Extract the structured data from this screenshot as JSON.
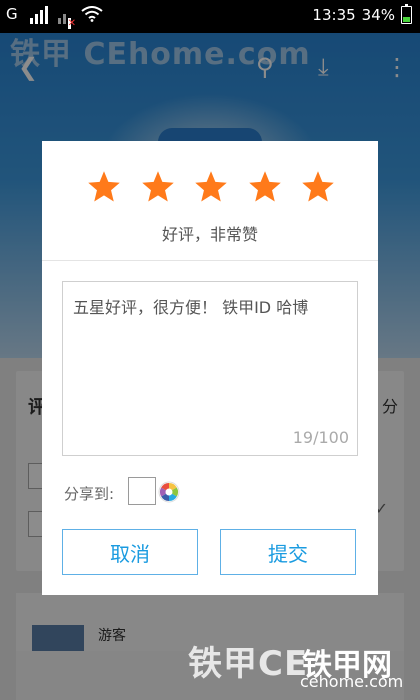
{
  "status_bar": {
    "network_label": "G",
    "time": "13:35",
    "battery_percent": "34%",
    "battery_level": 0.34,
    "icons": [
      "signal-icon",
      "sim-no-signal-icon",
      "wifi-icon",
      "battery-icon"
    ]
  },
  "background": {
    "brand_watermark": "铁甲 CEhome.com",
    "card_title_fragment": "评",
    "card_right_fragment": "分",
    "guest_label": "游客",
    "icons": [
      "back-icon",
      "search-icon",
      "download-icon",
      "more-icon"
    ]
  },
  "dialog": {
    "rating": {
      "value": 5,
      "max": 5,
      "color": "#ff7a1a"
    },
    "rating_text": "好评，非常赞",
    "review_text": "五星好评，很方便！ 铁甲ID 哈博",
    "char_counter": "19/100",
    "share_label": "分享到:",
    "cancel_label": "取消",
    "submit_label": "提交"
  },
  "watermark": {
    "bottom_text": "铁甲CE",
    "right_top_text": "铁甲网",
    "right_bottom_text": "cehome.com"
  },
  "colors": {
    "accent": "#1a9be0",
    "star": "#ff7a1a",
    "header_blue": "#2a86d6"
  }
}
